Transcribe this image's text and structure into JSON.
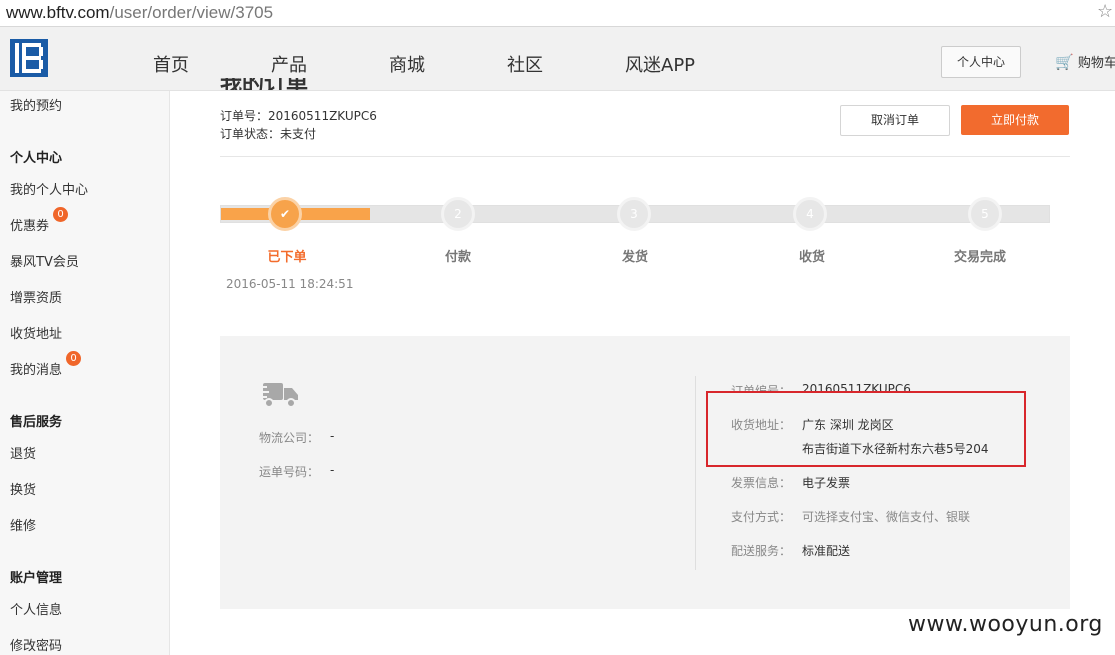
{
  "browser": {
    "url_host": "www.bftv.com",
    "url_path": "/user/order/view/3705",
    "star_icon": "star-icon"
  },
  "header": {
    "nav": [
      "首页",
      "产品",
      "商城",
      "社区",
      "风迷APP"
    ],
    "user_center_button": "个人中心",
    "cart_label": "购物车"
  },
  "sidebar": {
    "top_item": "我的预约",
    "section_personal": "个人中心",
    "items_personal": [
      "我的个人中心",
      "优惠券",
      "暴风TV会员",
      "增票资质",
      "收货地址",
      "我的消息"
    ],
    "coupon_count": "0",
    "message_count": "0",
    "section_service": "售后服务",
    "items_service": [
      "退货",
      "换货",
      "维修"
    ],
    "section_account": "账户管理",
    "items_account": [
      "个人信息",
      "修改密码"
    ]
  },
  "order": {
    "title_partial": "我的订单",
    "order_no_line": "订单号：20160511ZKUPC6",
    "status_line": "订单状态：未支付",
    "cancel_button": "取消订单",
    "pay_button": "立即付款",
    "progress_fraction": 0.18,
    "steps": [
      {
        "num": "✔",
        "label": "已下单",
        "done": true
      },
      {
        "num": "2",
        "label": "付款",
        "done": false
      },
      {
        "num": "3",
        "label": "发货",
        "done": false
      },
      {
        "num": "4",
        "label": "收货",
        "done": false
      },
      {
        "num": "5",
        "label": "交易完成",
        "done": false
      }
    ],
    "step1_time": "2016-05-11 18:24:51"
  },
  "logistics": {
    "truck_icon": "truck-icon",
    "company_label": "物流公司：",
    "company_value": "-",
    "tracking_label": "运单号码：",
    "tracking_value": "-"
  },
  "details": {
    "order_no_label": "订单编号：",
    "order_no_value": "20160511ZKUPC6",
    "address_label": "收货地址：",
    "address_line1": "广东 深圳 龙岗区",
    "address_line2": "布吉街道下水径新村东六巷5号204",
    "invoice_label": "发票信息：",
    "invoice_value": "电子发票",
    "payment_label": "支付方式：",
    "payment_value": "可选择支付宝、微信支付、银联",
    "delivery_label": "配送服务：",
    "delivery_value": "标准配送"
  },
  "watermark": "www.wooyun.org",
  "colors": {
    "accent": "#f26b2e",
    "progress": "#f9a34a",
    "highlight_box": "#d8262b",
    "badge": "#f0662a"
  }
}
